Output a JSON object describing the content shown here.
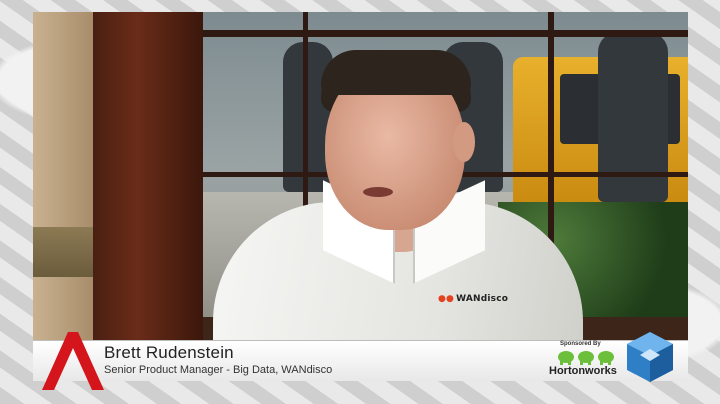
{
  "scene": {
    "shirt_logo": "WANdisco"
  },
  "lower_third": {
    "name": "Brett Rudenstein",
    "title": "Senior Product Manager - Big Data, WANdisco"
  },
  "sponsor": {
    "label": "Sponsored By",
    "name": "Hortonworks"
  },
  "colors": {
    "logo_red": "#d4151c",
    "elephant_green": "#6cbf3a",
    "cube_blue": "#2f7fc7"
  },
  "icons": {
    "channel_logo": "letter-a-logo-icon",
    "sponsor_logo": "elephants-icon",
    "cube_logo": "cube-icon"
  }
}
